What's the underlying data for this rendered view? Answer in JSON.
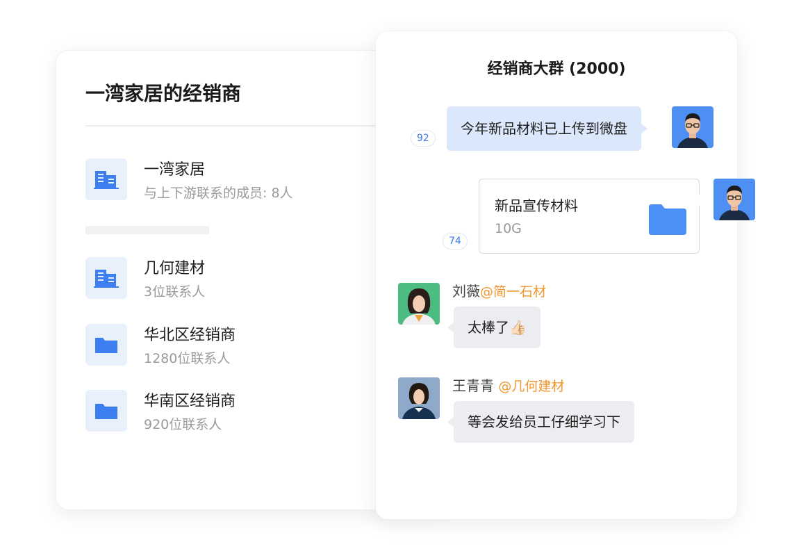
{
  "left_panel": {
    "title": "一湾家居的经销商",
    "orgs": [
      {
        "name": "一湾家居",
        "sub": "与上下游联系的成员: 8人",
        "icon": "building-icon"
      },
      {
        "name": "几何建材",
        "sub": "3位联系人",
        "icon": "building-icon"
      },
      {
        "name": "华北区经销商",
        "sub": "1280位联系人",
        "icon": "folder-icon"
      },
      {
        "name": "华南区经销商",
        "sub": "920位联系人",
        "icon": "folder-icon"
      }
    ]
  },
  "chat": {
    "group_title": "经销商大群 (2000)",
    "messages": [
      {
        "type": "text",
        "text": "今年新品材料已上传到微盘",
        "read_count": "92",
        "sender_avatar": "man-avatar"
      },
      {
        "type": "file",
        "file_name": "新品宣传材料",
        "file_size": "10G",
        "read_count": "74",
        "file_icon": "folder-icon",
        "sender_avatar": "man-avatar"
      },
      {
        "type": "text",
        "sender": "刘薇",
        "org": "@简一石材",
        "text": "太棒了👍🏻",
        "sender_avatar": "woman-avatar"
      },
      {
        "type": "text",
        "sender": "王青青",
        "org": "@几何建材",
        "text": "等会发给员工仔细学习下",
        "sender_avatar": "woman-avatar"
      }
    ]
  },
  "colors": {
    "accent": "#3d7ff0",
    "icon_bg": "#e8f0fb",
    "bubble_self": "#dbe8fc",
    "bubble_other": "#ebedf0",
    "org_tag": "#f0962f"
  }
}
